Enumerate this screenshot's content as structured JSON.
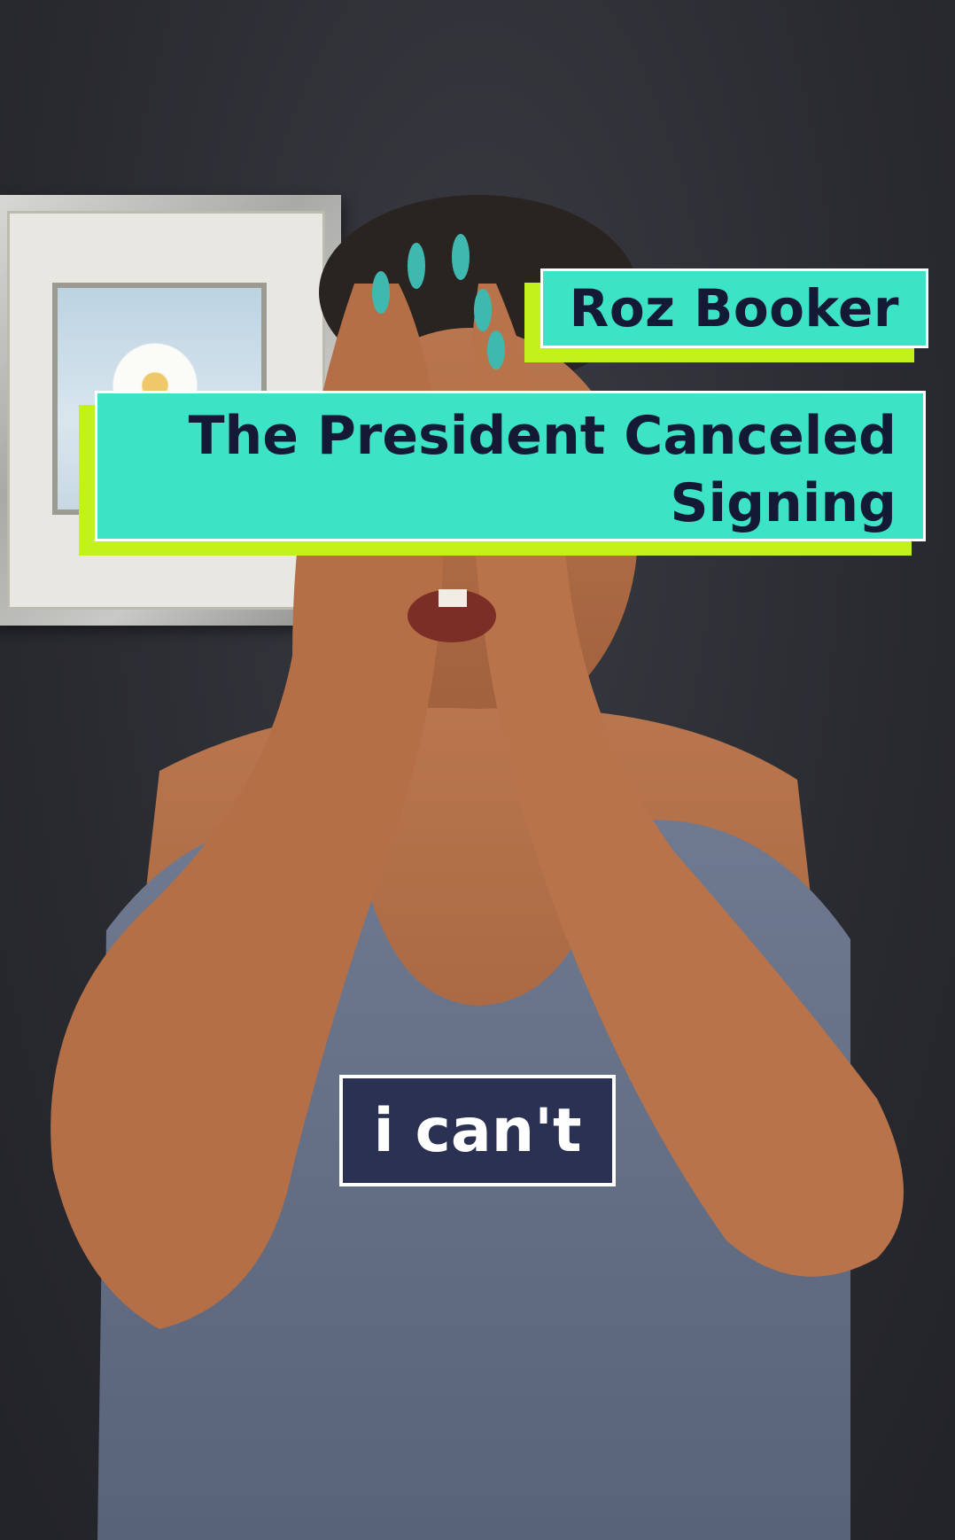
{
  "overlay": {
    "name": "Roz Booker",
    "headline": "The President Canceled Signing",
    "caption": "i can't"
  },
  "colors": {
    "tag_fill": "#3ce3c4",
    "tag_shadow": "#c2f11c",
    "tag_text": "#141a36",
    "caption_fill": "#2b3152",
    "caption_text": "#ffffff"
  }
}
